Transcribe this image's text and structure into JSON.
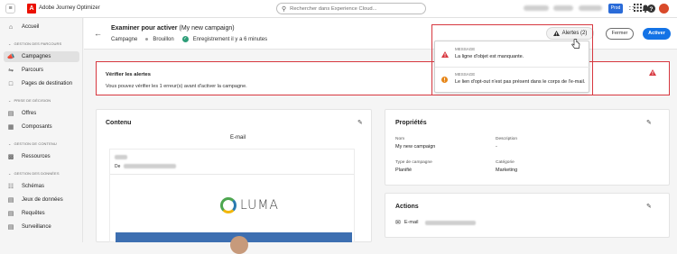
{
  "topbar": {
    "app_name": "Adobe Journey Optimizer",
    "search_placeholder": "Rechercher dans Experience Cloud...",
    "prod_badge": "Prod",
    "logo_letter": "A",
    "burger_glyph": "≡",
    "avatar_initial": "",
    "icons": [
      "grid-icon",
      "help-icon",
      "bell-icon",
      "avatar"
    ]
  },
  "sidebar": {
    "home": "Accueil",
    "sections": [
      {
        "label": "GESTION DES PARCOURS",
        "items": [
          "Campagnes",
          "Parcours",
          "Pages de destination"
        ]
      },
      {
        "label": "PRISE DE DÉCISION",
        "items": [
          "Offres",
          "Composants"
        ]
      },
      {
        "label": "GESTION DE CONTENU",
        "items": [
          "Ressources"
        ]
      },
      {
        "label": "GESTION DES DONNÉES",
        "items": [
          "Schémas",
          "Jeux de données",
          "Requêtes",
          "Surveillance"
        ]
      }
    ]
  },
  "header": {
    "title": "Examiner pour activer",
    "title_campaign": "(My new campaign)",
    "type": "Campagne",
    "status": "Brouillon",
    "saved": "Enregistrement il y a 6 minutes",
    "alerts_button": "Alertes (2)",
    "close_button": "Fermer",
    "activate_button": "Activer"
  },
  "alerts": [
    {
      "label": "MESSAGE",
      "text": "La ligne d'objet est manquante.",
      "severity": "error",
      "color": "#d7373f"
    },
    {
      "label": "MESSAGE",
      "text": "Le lien d'opt-out n'est pas présent dans le corps de l'e-mail.",
      "severity": "warning",
      "color": "#e68619"
    }
  ],
  "verify": {
    "title": "Vérifier les alertes",
    "text": "Vous pouvez vérifier les 1 erreur(s) avant d'activer la campagne."
  },
  "content": {
    "title": "Contenu",
    "tab": "E-mail",
    "from_label": "De",
    "brand": "LUMA"
  },
  "properties": {
    "title": "Propriétés",
    "fields": [
      {
        "label": "Nom",
        "value": "My new campaign"
      },
      {
        "label": "Description",
        "value": "-"
      },
      {
        "label": "Type de campagne",
        "value": "Planifié"
      },
      {
        "label": "Catégorie",
        "value": "Marketing"
      }
    ]
  },
  "actions": {
    "title": "Actions",
    "channel": "E-mail"
  },
  "colors": {
    "accent": "#1473e6",
    "error": "#d7373f",
    "warning": "#e68619",
    "success": "#2d9d78"
  }
}
